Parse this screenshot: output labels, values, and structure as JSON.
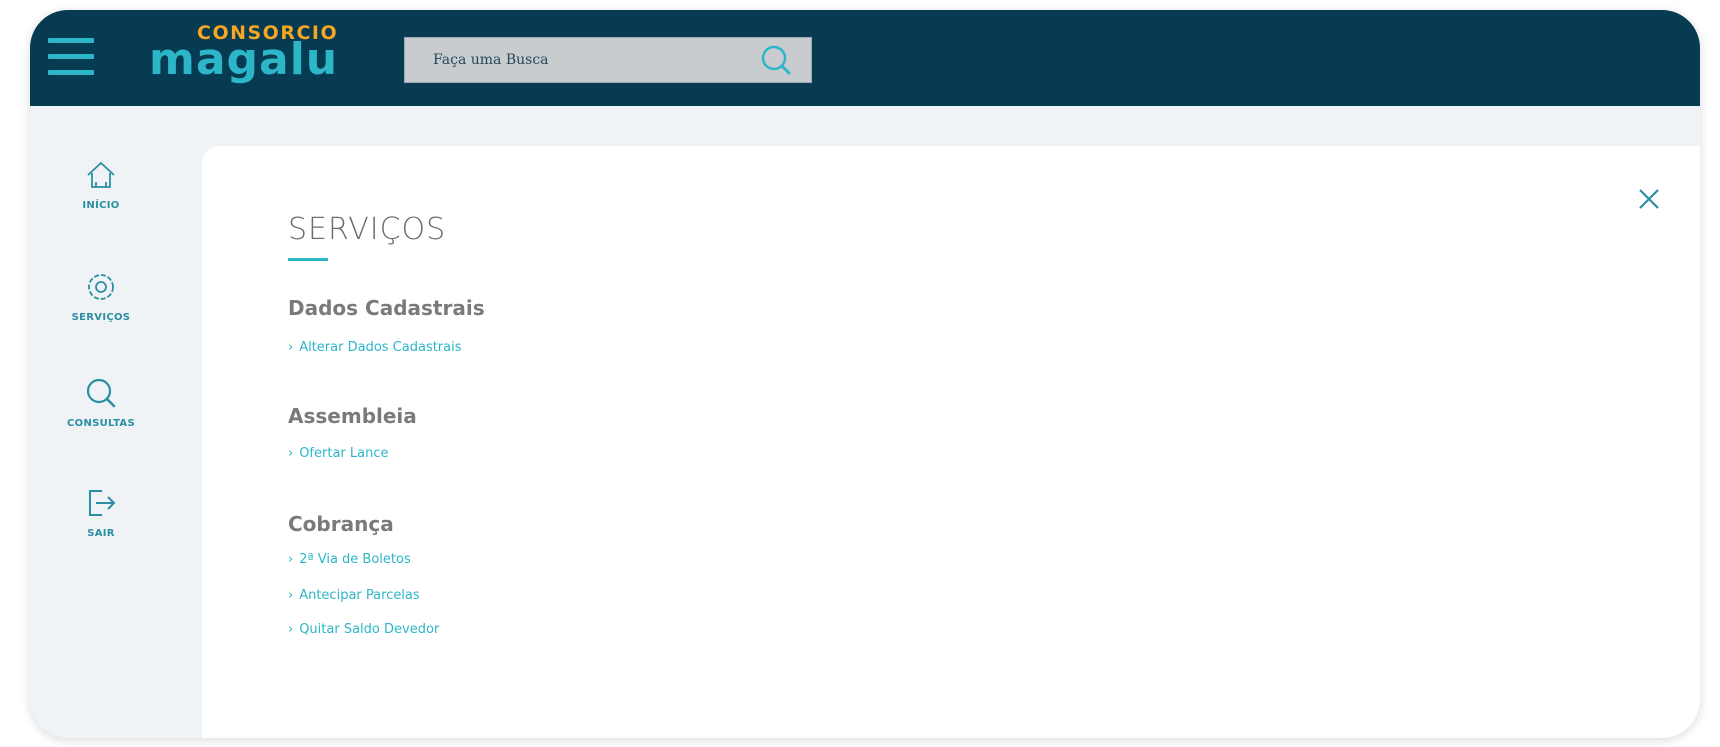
{
  "header": {
    "logo_top": "CONSORCIO",
    "logo_main": "magalu",
    "search_placeholder": "Faça uma Busca"
  },
  "sidebar": {
    "items": [
      {
        "label": "INÍCIO",
        "icon": "home-icon"
      },
      {
        "label": "SERVIÇOS",
        "icon": "gear-icon"
      },
      {
        "label": "CONSULTAS",
        "icon": "search-icon"
      },
      {
        "label": "SAIR",
        "icon": "logout-icon"
      }
    ]
  },
  "main": {
    "title": "SERVIÇOS",
    "close_icon": "close-icon",
    "sections": [
      {
        "title": "Dados Cadastrais",
        "links": [
          "Alterar Dados Cadastrais"
        ]
      },
      {
        "title": "Assembleia",
        "links": [
          "Ofertar Lance"
        ]
      },
      {
        "title": "Cobrança",
        "links": [
          "2ª Via de Boletos",
          "Antecipar Parcelas",
          "Quitar Saldo Devedor"
        ]
      }
    ]
  },
  "colors": {
    "header_bg": "#063b52",
    "accent": "#2db6c8",
    "logo_orange": "#f5a623",
    "background": "#eff3f5"
  }
}
